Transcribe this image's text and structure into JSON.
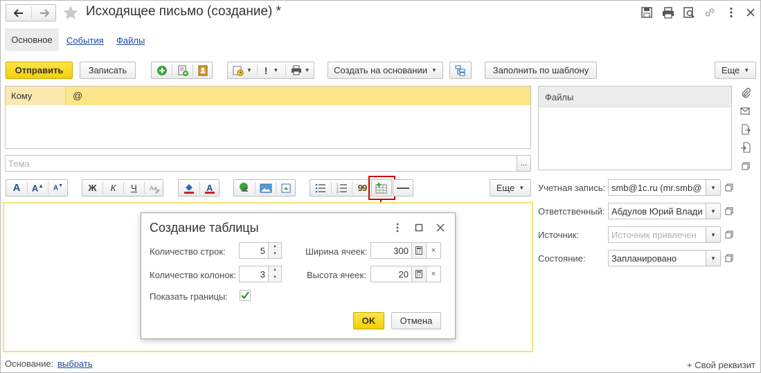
{
  "window": {
    "title": "Исходящее письмо  (создание) *",
    "back_icon": "arrow-left-icon",
    "forward_icon": "arrow-right-icon",
    "favorite_icon": "star-icon"
  },
  "tabs": [
    {
      "label": "Основное",
      "active": true
    },
    {
      "label": "События",
      "active": false
    },
    {
      "label": "Файлы",
      "active": false
    }
  ],
  "toolbar": {
    "send_label": "Отправить",
    "save_label": "Записать",
    "create_based_label": "Создать на основании",
    "fill_template_label": "Заполнить по шаблону",
    "more_label": "Еще"
  },
  "recipients": {
    "to_label": "Кому",
    "to_value": "@"
  },
  "subject": {
    "placeholder": "Тема",
    "ellipsis": "..."
  },
  "editor_toolbar": {
    "bold": "Ж",
    "italic": "К",
    "underline": "Ч",
    "quote": "99",
    "more_label": "Еще"
  },
  "files_panel": {
    "header": "Файлы"
  },
  "properties": {
    "account_label": "Учетная запись:",
    "account_value": "smb@1c.ru (mr.smb@",
    "responsible_label": "Ответственный:",
    "responsible_value": "Абдулов Юрий Влади",
    "source_label": "Источник:",
    "source_placeholder": "Источник привлечен",
    "state_label": "Состояние:",
    "state_value": "Запланировано"
  },
  "footer": {
    "basis_label": "Основание:",
    "basis_link": "выбрать",
    "custom_attr": "+ Свой реквизит"
  },
  "dialog": {
    "title": "Создание таблицы",
    "rows_label": "Количество строк:",
    "rows_value": "5",
    "cols_label": "Количество колонок:",
    "cols_value": "3",
    "borders_label": "Показать границы:",
    "borders_checked": true,
    "cell_width_label": "Ширина ячеек:",
    "cell_width_value": "300",
    "cell_height_label": "Высота ячеек:",
    "cell_height_value": "20",
    "ok_label": "OK",
    "cancel_label": "Отмена"
  },
  "colors": {
    "accent_yellow": "#f5cf06",
    "to_row_bg": "#fde68a",
    "highlight_red": "#d00000",
    "link_blue": "#1a4ba0"
  }
}
